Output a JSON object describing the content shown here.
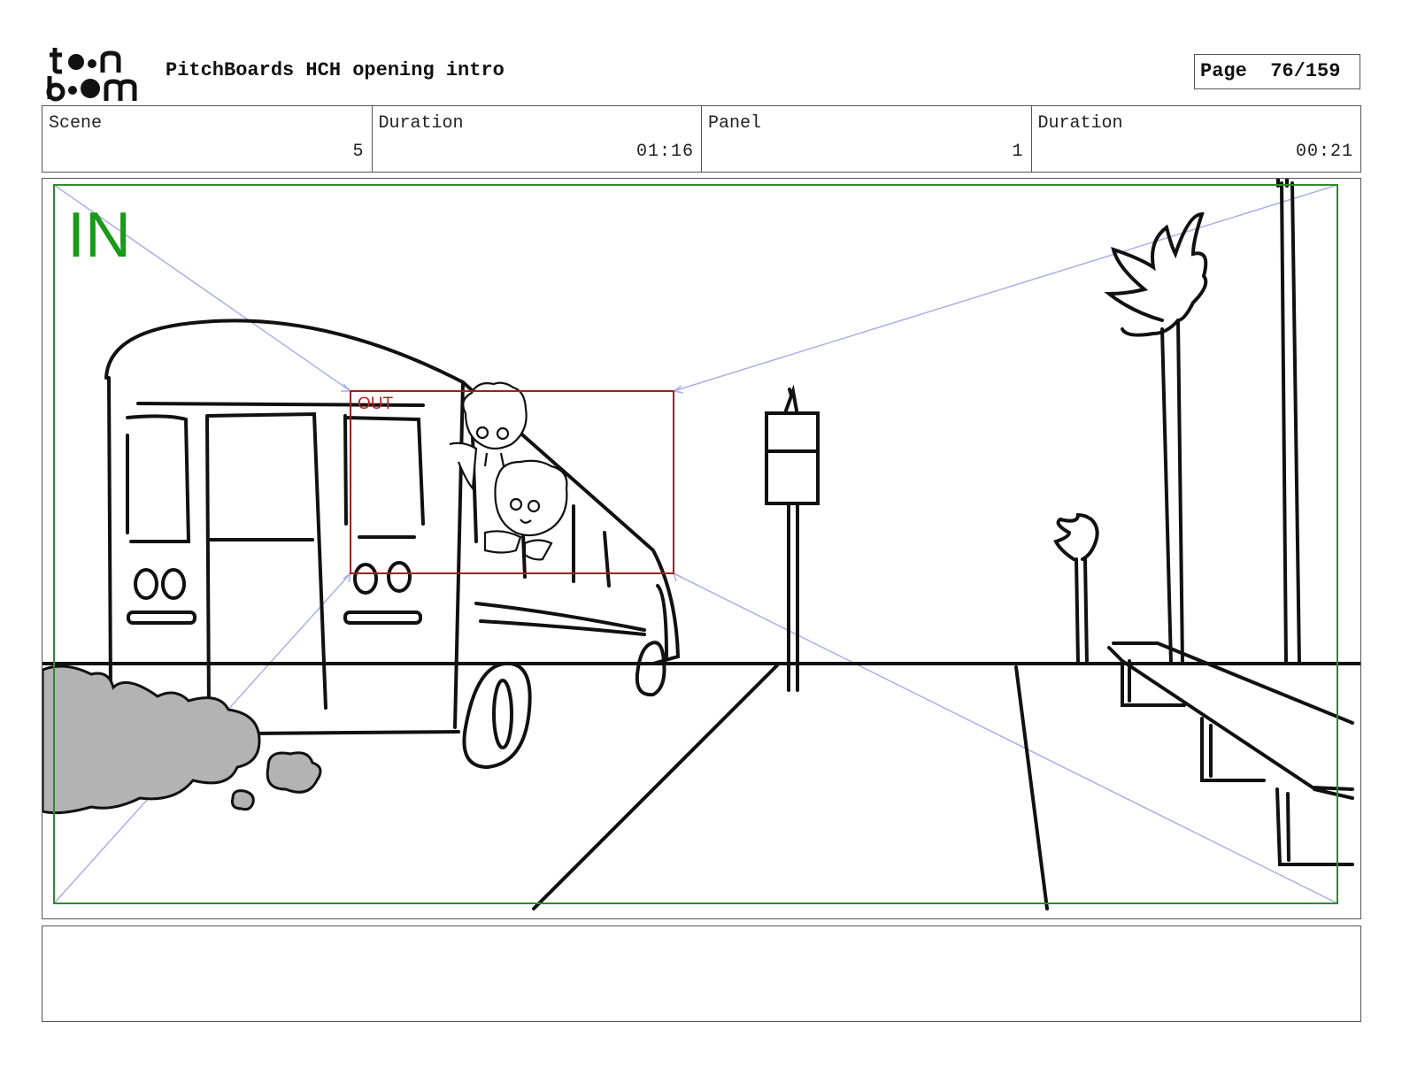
{
  "header": {
    "logo_text_top": "toon",
    "logo_text_bottom": "boom",
    "project_title": "PitchBoards HCH opening intro",
    "page_label": "Page",
    "page_value": "76/159"
  },
  "info": {
    "scene_label": "Scene",
    "scene_value": "5",
    "scene_duration_label": "Duration",
    "scene_duration_value": "01:16",
    "panel_label": "Panel",
    "panel_value": "1",
    "panel_duration_label": "Duration",
    "panel_duration_value": "00:21"
  },
  "panel": {
    "in_label": "IN",
    "out_label": "OUT",
    "colors": {
      "in_frame": "#2e8b2e",
      "out_frame": "#a31f1f",
      "camera_lines": "#aab0e6",
      "smoke": "#b3b3b3"
    }
  },
  "notes": {}
}
